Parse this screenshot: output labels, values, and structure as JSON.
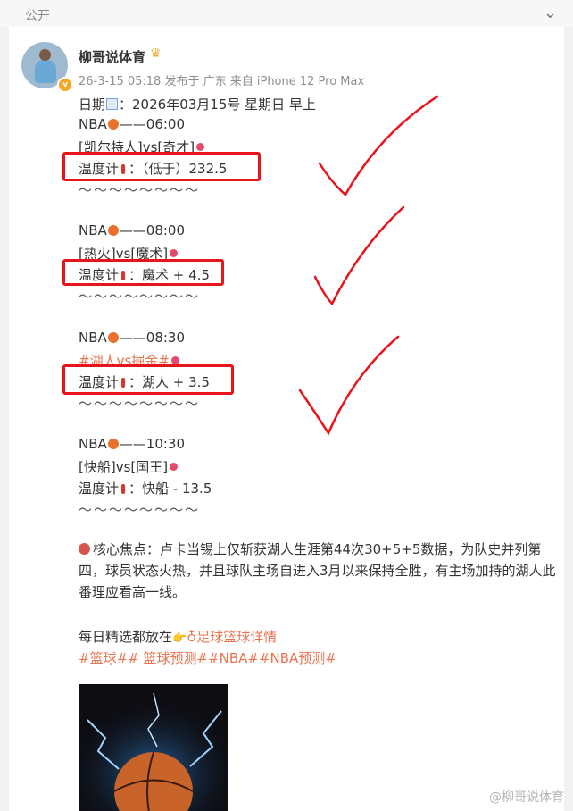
{
  "topbar": {
    "label": "公开",
    "chevron_icon": "chevron-down-icon"
  },
  "author": {
    "name": "柳哥说体育",
    "crown_icon": "crown-icon",
    "meta": "26-3-15 05:18  发布于 广东  来自 iPhone 12 Pro Max"
  },
  "post": {
    "date_prefix": "日期",
    "date_value": "：2026年03月15号 星期日  早上",
    "games": [
      {
        "header_prefix": "NBA",
        "header_time": "——06:00",
        "matchup": "[凯尔特人]vs[奇才]",
        "is_hashtag": false,
        "pick_label": "温度计",
        "pick_value": "：（低于）232.5"
      },
      {
        "header_prefix": "NBA",
        "header_time": "——08:00",
        "matchup": "[热火]vs[魔术]",
        "is_hashtag": false,
        "pick_label": "温度计",
        "pick_value": "：魔术 + 4.5"
      },
      {
        "header_prefix": "NBA",
        "header_time": "——08:30",
        "matchup": "#湖人vs掘金#",
        "is_hashtag": true,
        "pick_label": "温度计",
        "pick_value": "：湖人 + 3.5"
      },
      {
        "header_prefix": "NBA",
        "header_time": "——10:30",
        "matchup": "[快船]vs[国王]",
        "is_hashtag": false,
        "pick_label": "温度计",
        "pick_value": "：快船 - 13.5"
      }
    ],
    "separator": "～～～～～～～～",
    "focus_text": "核心焦点：卢卡当锡上仅斩获湖人生涯第44次30+5+5数据，为队史并列第四，球员状态火热，并且球队主场自进入3月以来保持全胜，有主场加持的湖人此番理应看高一线。",
    "daily_prefix": "每日精选都放在",
    "daily_link": "足球篮球详情",
    "hashtags": "#篮球## 篮球预测##NBA##NBA预测#",
    "image_alt": "basketball-lightning-image"
  },
  "watermark": "@柳哥说体育",
  "colors": {
    "link": "#eb7350",
    "box": "#e8141b",
    "check": "#e8141b"
  }
}
